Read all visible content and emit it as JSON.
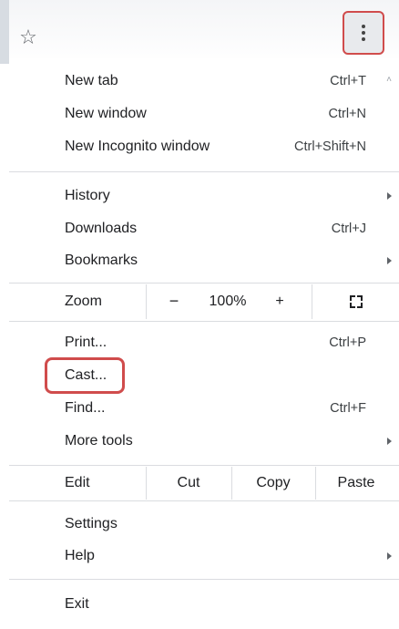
{
  "toolbar": {
    "star_icon": "☆",
    "menu_icon": "more-vert-icon"
  },
  "menu": {
    "group1": [
      {
        "label": "New tab",
        "shortcut": "Ctrl+T"
      },
      {
        "label": "New window",
        "shortcut": "Ctrl+N"
      },
      {
        "label": "New Incognito window",
        "shortcut": "Ctrl+Shift+N"
      }
    ],
    "group2": [
      {
        "label": "History",
        "shortcut": ""
      },
      {
        "label": "Downloads",
        "shortcut": "Ctrl+J"
      },
      {
        "label": "Bookmarks",
        "shortcut": ""
      }
    ],
    "zoom": {
      "label": "Zoom",
      "minus": "−",
      "value": "100%",
      "plus": "+"
    },
    "group3": [
      {
        "label": "Print...",
        "shortcut": "Ctrl+P"
      },
      {
        "label": "Cast...",
        "shortcut": ""
      },
      {
        "label": "Find...",
        "shortcut": "Ctrl+F"
      },
      {
        "label": "More tools",
        "shortcut": ""
      }
    ],
    "edit": {
      "label": "Edit",
      "cut": "Cut",
      "copy": "Copy",
      "paste": "Paste"
    },
    "group4": [
      {
        "label": "Settings",
        "shortcut": ""
      },
      {
        "label": "Help",
        "shortcut": ""
      }
    ],
    "exit": {
      "label": "Exit"
    }
  },
  "colors": {
    "highlight": "#d04c4c",
    "separator": "#dadce0"
  }
}
